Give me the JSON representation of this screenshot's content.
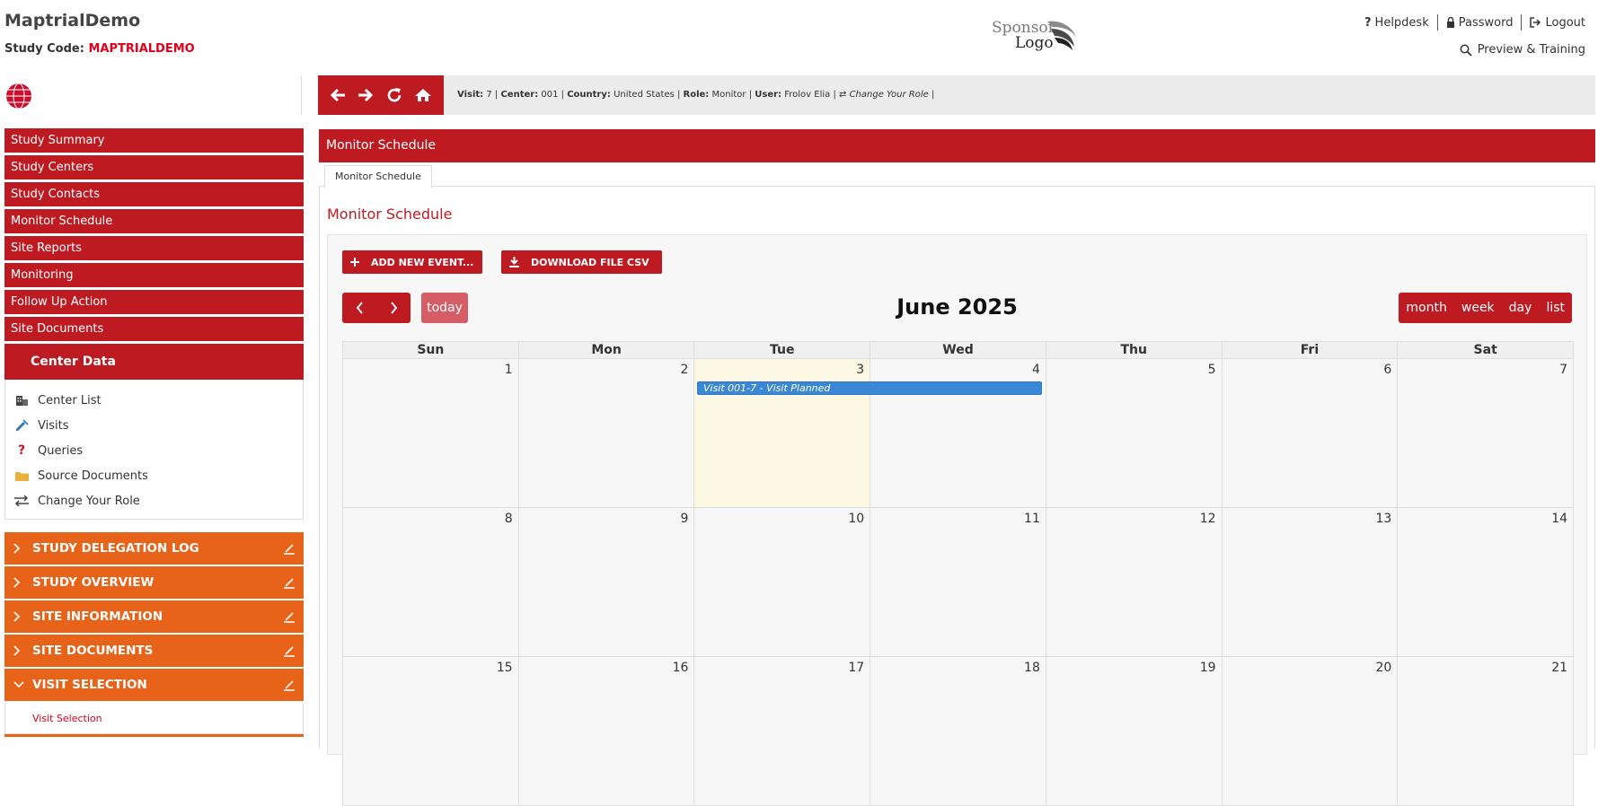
{
  "header": {
    "app_title": "MaptrialDemo",
    "study_code_label": "Study Code:",
    "study_code_value": "MAPTRIALDEMO",
    "sponsor_logo_line1": "Sponsor",
    "sponsor_logo_line2": "Logo",
    "links": {
      "helpdesk": "Helpdesk",
      "password": "Password",
      "logout": "Logout",
      "preview": "Preview & Training"
    }
  },
  "sidebar": {
    "items": [
      {
        "label": "Study Summary"
      },
      {
        "label": "Study Centers"
      },
      {
        "label": "Study Contacts"
      },
      {
        "label": "Monitor Schedule"
      },
      {
        "label": "Site Reports"
      },
      {
        "label": "Monitoring"
      },
      {
        "label": "Follow Up Action"
      },
      {
        "label": "Site Documents"
      }
    ],
    "center_data": {
      "title": "Center Data",
      "items": [
        {
          "label": "Center List",
          "icon": "building-icon"
        },
        {
          "label": "Visits",
          "icon": "syringe-icon"
        },
        {
          "label": "Queries",
          "icon": "question-icon"
        },
        {
          "label": "Source Documents",
          "icon": "folder-icon"
        },
        {
          "label": "Change Your Role",
          "icon": "swap-icon"
        }
      ]
    },
    "accordion": [
      {
        "label": "STUDY DELEGATION LOG",
        "expanded": false
      },
      {
        "label": "STUDY OVERVIEW",
        "expanded": false
      },
      {
        "label": "SITE INFORMATION",
        "expanded": false
      },
      {
        "label": "SITE DOCUMENTS",
        "expanded": false
      },
      {
        "label": "VISIT SELECTION",
        "expanded": true,
        "sub_item": "Visit Selection"
      }
    ]
  },
  "toolbar": {
    "visit_label": "Visit:",
    "visit_value": "7",
    "center_label": "Center:",
    "center_value": "001",
    "country_label": "Country:",
    "country_value": "United States",
    "role_label": "Role:",
    "role_value": "Monitor",
    "user_label": "User:",
    "user_value": "Frolov Elia",
    "change_role": "Change Your Role"
  },
  "main": {
    "panel_title": "Monitor Schedule",
    "tab_label": "Monitor Schedule",
    "page_heading": "Monitor Schedule",
    "buttons": {
      "add_event": "ADD NEW EVENT...",
      "download_csv": "DOWNLOAD FILE CSV"
    }
  },
  "calendar": {
    "title": "June 2025",
    "today_label": "today",
    "views": [
      "month",
      "week",
      "day",
      "list"
    ],
    "weekdays": [
      "Sun",
      "Mon",
      "Tue",
      "Wed",
      "Thu",
      "Fri",
      "Sat"
    ],
    "weeks": [
      [
        "1",
        "2",
        "3",
        "4",
        "5",
        "6",
        "7"
      ],
      [
        "8",
        "9",
        "10",
        "11",
        "12",
        "13",
        "14"
      ],
      [
        "15",
        "16",
        "17",
        "18",
        "19",
        "20",
        "21"
      ]
    ],
    "today": "3",
    "events": [
      {
        "title": "Visit 001-7 - Visit Planned",
        "start": "2025-06-03",
        "end": "2025-06-04",
        "color": "#3a87d6"
      }
    ]
  },
  "colors": {
    "brand_red": "#bd1a22",
    "accent_orange": "#e8631a",
    "code_red": "#e0001b",
    "event_blue": "#3a87d6"
  }
}
